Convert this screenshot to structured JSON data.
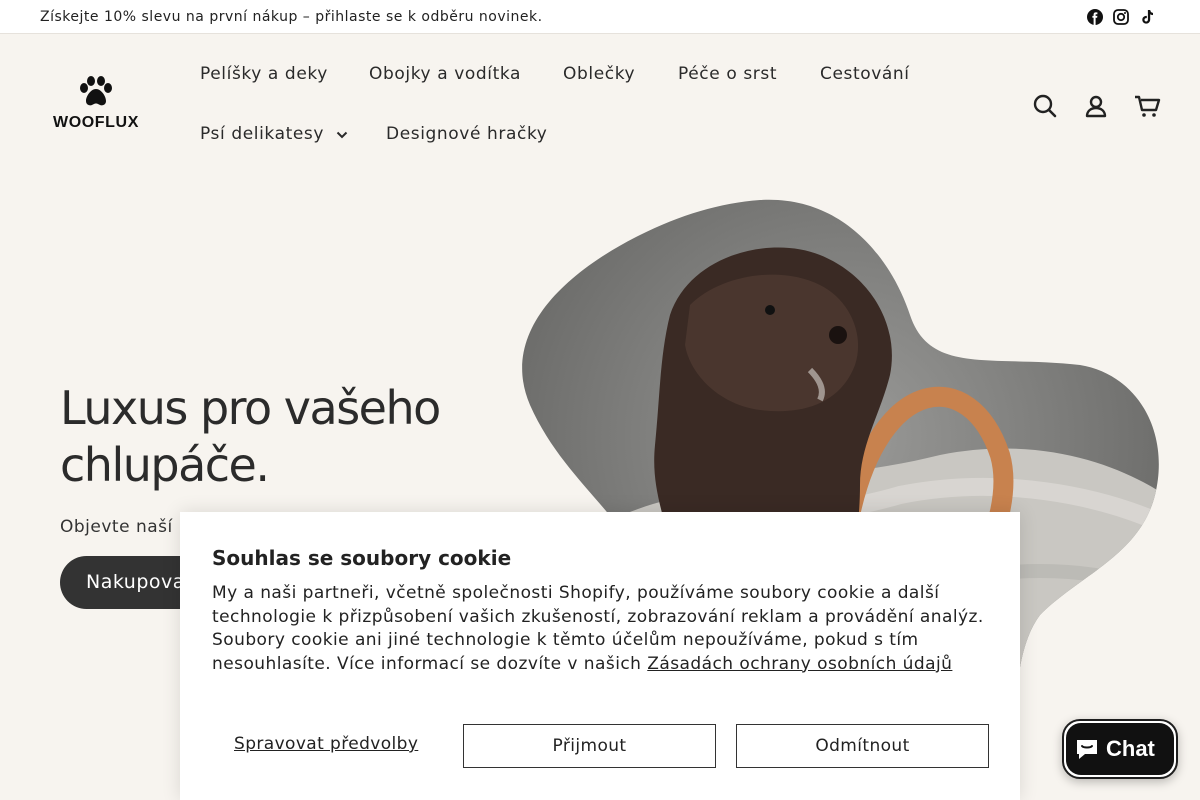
{
  "announcement": {
    "text": "Získejte 10% slevu na první nákup – přihlaste se k odběru novinek."
  },
  "social": {
    "icons": [
      "facebook-icon",
      "instagram-icon",
      "tiktok-icon"
    ]
  },
  "logo": {
    "text": "WOOFLUX",
    "icon": "paw-icon"
  },
  "nav": {
    "items": [
      {
        "label": "Pelíšky a deky"
      },
      {
        "label": "Obojky a vodítka"
      },
      {
        "label": "Oblečky"
      },
      {
        "label": "Péče o srst"
      },
      {
        "label": "Cestování"
      },
      {
        "label": "Psí delikatesy",
        "has_dropdown": true
      },
      {
        "label": "Designové hračky"
      }
    ]
  },
  "header_icons": [
    "search-icon",
    "account-icon",
    "cart-icon"
  ],
  "hero": {
    "title": "Luxus pro vašeho chlupáče.",
    "subtitle": "Objevte naší",
    "button_label": "Nakupovat"
  },
  "cookie": {
    "title": "Souhlas se soubory cookie",
    "body": "My a naši partneři, včetně společnosti Shopify, používáme soubory cookie a další technologie k přizpůsobení vašich zkušeností, zobrazování reklam a provádění analýz. Soubory cookie ani jiné technologie k těmto účelům nepoužíváme, pokud s tím nesouhlasíte. Více informací se dozvíte v našich",
    "link": "Zásadách ochrany osobních údajů",
    "manage_label": "Spravovat předvolby",
    "accept_label": "Přijmout",
    "decline_label": "Odmítnout"
  },
  "chat": {
    "label": "Chat",
    "icon": "chat-bubble-icon"
  },
  "colors": {
    "background": "#f7f4ef",
    "button_dark": "#333333",
    "chat_bg": "#111111"
  }
}
